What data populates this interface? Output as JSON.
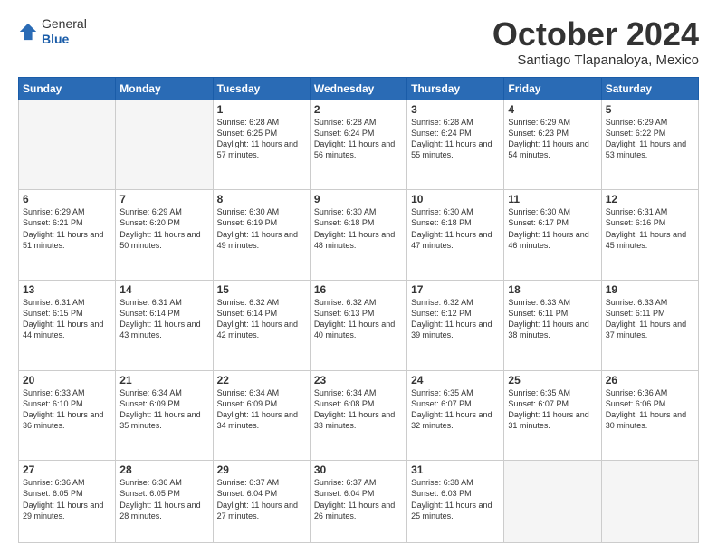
{
  "header": {
    "logo_line1": "General",
    "logo_line2": "Blue",
    "month": "October 2024",
    "location": "Santiago Tlapanaloya, Mexico"
  },
  "weekdays": [
    "Sunday",
    "Monday",
    "Tuesday",
    "Wednesday",
    "Thursday",
    "Friday",
    "Saturday"
  ],
  "weeks": [
    [
      {
        "day": "",
        "info": ""
      },
      {
        "day": "",
        "info": ""
      },
      {
        "day": "1",
        "info": "Sunrise: 6:28 AM\nSunset: 6:25 PM\nDaylight: 11 hours and 57 minutes."
      },
      {
        "day": "2",
        "info": "Sunrise: 6:28 AM\nSunset: 6:24 PM\nDaylight: 11 hours and 56 minutes."
      },
      {
        "day": "3",
        "info": "Sunrise: 6:28 AM\nSunset: 6:24 PM\nDaylight: 11 hours and 55 minutes."
      },
      {
        "day": "4",
        "info": "Sunrise: 6:29 AM\nSunset: 6:23 PM\nDaylight: 11 hours and 54 minutes."
      },
      {
        "day": "5",
        "info": "Sunrise: 6:29 AM\nSunset: 6:22 PM\nDaylight: 11 hours and 53 minutes."
      }
    ],
    [
      {
        "day": "6",
        "info": "Sunrise: 6:29 AM\nSunset: 6:21 PM\nDaylight: 11 hours and 51 minutes."
      },
      {
        "day": "7",
        "info": "Sunrise: 6:29 AM\nSunset: 6:20 PM\nDaylight: 11 hours and 50 minutes."
      },
      {
        "day": "8",
        "info": "Sunrise: 6:30 AM\nSunset: 6:19 PM\nDaylight: 11 hours and 49 minutes."
      },
      {
        "day": "9",
        "info": "Sunrise: 6:30 AM\nSunset: 6:18 PM\nDaylight: 11 hours and 48 minutes."
      },
      {
        "day": "10",
        "info": "Sunrise: 6:30 AM\nSunset: 6:18 PM\nDaylight: 11 hours and 47 minutes."
      },
      {
        "day": "11",
        "info": "Sunrise: 6:30 AM\nSunset: 6:17 PM\nDaylight: 11 hours and 46 minutes."
      },
      {
        "day": "12",
        "info": "Sunrise: 6:31 AM\nSunset: 6:16 PM\nDaylight: 11 hours and 45 minutes."
      }
    ],
    [
      {
        "day": "13",
        "info": "Sunrise: 6:31 AM\nSunset: 6:15 PM\nDaylight: 11 hours and 44 minutes."
      },
      {
        "day": "14",
        "info": "Sunrise: 6:31 AM\nSunset: 6:14 PM\nDaylight: 11 hours and 43 minutes."
      },
      {
        "day": "15",
        "info": "Sunrise: 6:32 AM\nSunset: 6:14 PM\nDaylight: 11 hours and 42 minutes."
      },
      {
        "day": "16",
        "info": "Sunrise: 6:32 AM\nSunset: 6:13 PM\nDaylight: 11 hours and 40 minutes."
      },
      {
        "day": "17",
        "info": "Sunrise: 6:32 AM\nSunset: 6:12 PM\nDaylight: 11 hours and 39 minutes."
      },
      {
        "day": "18",
        "info": "Sunrise: 6:33 AM\nSunset: 6:11 PM\nDaylight: 11 hours and 38 minutes."
      },
      {
        "day": "19",
        "info": "Sunrise: 6:33 AM\nSunset: 6:11 PM\nDaylight: 11 hours and 37 minutes."
      }
    ],
    [
      {
        "day": "20",
        "info": "Sunrise: 6:33 AM\nSunset: 6:10 PM\nDaylight: 11 hours and 36 minutes."
      },
      {
        "day": "21",
        "info": "Sunrise: 6:34 AM\nSunset: 6:09 PM\nDaylight: 11 hours and 35 minutes."
      },
      {
        "day": "22",
        "info": "Sunrise: 6:34 AM\nSunset: 6:09 PM\nDaylight: 11 hours and 34 minutes."
      },
      {
        "day": "23",
        "info": "Sunrise: 6:34 AM\nSunset: 6:08 PM\nDaylight: 11 hours and 33 minutes."
      },
      {
        "day": "24",
        "info": "Sunrise: 6:35 AM\nSunset: 6:07 PM\nDaylight: 11 hours and 32 minutes."
      },
      {
        "day": "25",
        "info": "Sunrise: 6:35 AM\nSunset: 6:07 PM\nDaylight: 11 hours and 31 minutes."
      },
      {
        "day": "26",
        "info": "Sunrise: 6:36 AM\nSunset: 6:06 PM\nDaylight: 11 hours and 30 minutes."
      }
    ],
    [
      {
        "day": "27",
        "info": "Sunrise: 6:36 AM\nSunset: 6:05 PM\nDaylight: 11 hours and 29 minutes."
      },
      {
        "day": "28",
        "info": "Sunrise: 6:36 AM\nSunset: 6:05 PM\nDaylight: 11 hours and 28 minutes."
      },
      {
        "day": "29",
        "info": "Sunrise: 6:37 AM\nSunset: 6:04 PM\nDaylight: 11 hours and 27 minutes."
      },
      {
        "day": "30",
        "info": "Sunrise: 6:37 AM\nSunset: 6:04 PM\nDaylight: 11 hours and 26 minutes."
      },
      {
        "day": "31",
        "info": "Sunrise: 6:38 AM\nSunset: 6:03 PM\nDaylight: 11 hours and 25 minutes."
      },
      {
        "day": "",
        "info": ""
      },
      {
        "day": "",
        "info": ""
      }
    ]
  ]
}
